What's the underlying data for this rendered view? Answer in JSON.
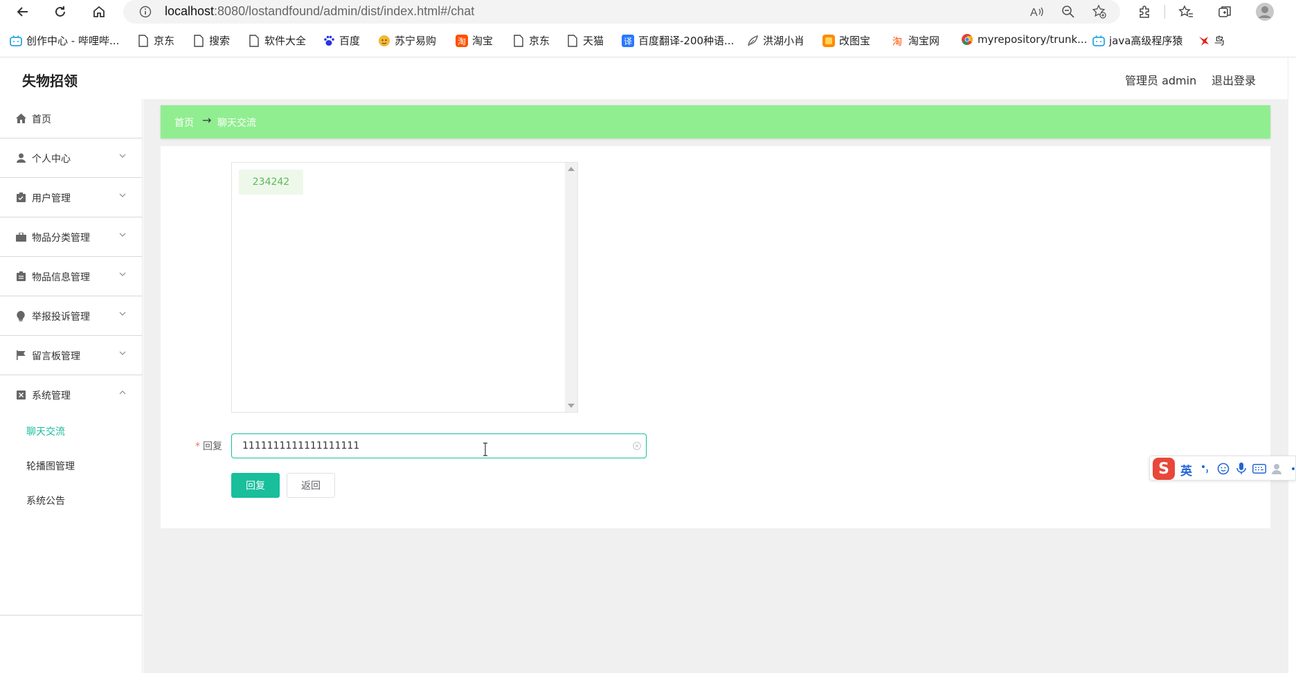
{
  "browser": {
    "url_host": "localhost",
    "url_rest": ":8080/lostandfound/admin/dist/index.html#/chat",
    "bookmarks": [
      {
        "label": "创作中心 - 哔哩哔...",
        "icon": "bilibili-icon"
      },
      {
        "label": "京东",
        "icon": "page-icon"
      },
      {
        "label": "搜索",
        "icon": "page-icon"
      },
      {
        "label": "软件大全",
        "icon": "page-icon"
      },
      {
        "label": "百度",
        "icon": "baidu-paw-icon"
      },
      {
        "label": "苏宁易购",
        "icon": "suning-icon"
      },
      {
        "label": "淘宝",
        "icon": "taobao-icon"
      },
      {
        "label": "京东",
        "icon": "page-icon"
      },
      {
        "label": "天猫",
        "icon": "page-icon"
      },
      {
        "label": "百度翻译-200种语...",
        "icon": "translate-icon"
      },
      {
        "label": "洪湖小肖",
        "icon": "feather-icon"
      },
      {
        "label": "改图宝",
        "icon": "gaitubao-icon"
      },
      {
        "label": "淘宝网",
        "icon": "taobao-icon"
      },
      {
        "label": "myrepository/trunk...",
        "icon": "chrome-icon"
      },
      {
        "label": "java高级程序猿",
        "icon": "bilibili-icon"
      },
      {
        "label": "鸟",
        "icon": "bird-icon"
      }
    ]
  },
  "header": {
    "title": "失物招领",
    "admin": "管理员 admin",
    "logout": "退出登录"
  },
  "sidebar": {
    "items": [
      {
        "label": "首页",
        "icon": "home-icon"
      },
      {
        "label": "个人中心",
        "icon": "user-icon"
      },
      {
        "label": "用户管理",
        "icon": "clipboard-icon"
      },
      {
        "label": "物品分类管理",
        "icon": "briefcase-icon"
      },
      {
        "label": "物品信息管理",
        "icon": "clipboard-list-icon"
      },
      {
        "label": "举报投诉管理",
        "icon": "lightbulb-icon"
      },
      {
        "label": "留言板管理",
        "icon": "flag-icon"
      },
      {
        "label": "系统管理",
        "icon": "close-box-icon"
      }
    ],
    "sub_items": [
      {
        "label": "聊天交流",
        "active": true
      },
      {
        "label": "轮播图管理",
        "active": false
      },
      {
        "label": "系统公告",
        "active": false
      }
    ]
  },
  "breadcrumb": {
    "home": "首页",
    "arrow": "→",
    "current": "聊天交流"
  },
  "chat": {
    "messages": [
      "234242"
    ]
  },
  "form": {
    "reply_label": "回复",
    "required_mark": "*",
    "reply_value": "1111111111111111111",
    "submit": "回复",
    "back": "返回"
  },
  "ime": {
    "logo": "S",
    "lang": "英"
  },
  "colors": {
    "accent": "#19be9b",
    "breadcrumb_bg": "#90ee90",
    "chat_bubble_bg": "#eef8ea",
    "chat_bubble_text": "#5cb85c"
  }
}
